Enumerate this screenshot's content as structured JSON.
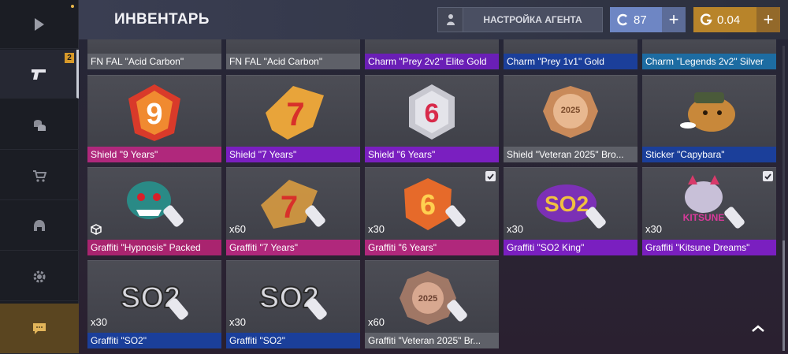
{
  "header": {
    "title": "ИНВЕНТАРЬ",
    "agent_button": "НАСТРОЙКА АГЕНТА",
    "currency_blue": "87",
    "currency_gold": "0.04",
    "plus": "+"
  },
  "sidebar": {
    "items": [
      {
        "icon": "play-icon"
      },
      {
        "icon": "pistol-icon",
        "badge": "2"
      },
      {
        "icon": "coins-icon"
      },
      {
        "icon": "cart-icon"
      },
      {
        "icon": "helmet-icon"
      },
      {
        "icon": "gear-icon"
      },
      {
        "icon": "chat-icon"
      }
    ]
  },
  "colors": {
    "grey": "#5e6068",
    "purple": "#6a1fb6",
    "blue": "#1b3f9a",
    "teal": "#1d6ca2",
    "pink": "#b0287c",
    "violet": "#7a1fc0",
    "magenta": "#a9246f"
  },
  "items": [
    {
      "name": "FN FAL \"Acid Carbon\"",
      "qty": "",
      "rarity": "grey"
    },
    {
      "name": "FN FAL \"Acid Carbon\"",
      "qty": "",
      "rarity": "grey"
    },
    {
      "name": "Charm \"Prey 2v2\" Elite Gold",
      "qty": "",
      "rarity": "purple"
    },
    {
      "name": "Charm \"Prey 1v1\" Gold",
      "qty": "",
      "rarity": "blue"
    },
    {
      "name": "Charm \"Legends 2v2\" Silver",
      "qty": "",
      "rarity": "teal"
    },
    {
      "name": "Shield \"9 Years\"",
      "qty": "",
      "rarity": "pink"
    },
    {
      "name": "Shield \"7 Years\"",
      "qty": "",
      "rarity": "violet"
    },
    {
      "name": "Shield \"6 Years\"",
      "qty": "",
      "rarity": "violet"
    },
    {
      "name": "Shield \"Veteran 2025\" Bro...",
      "qty": "",
      "rarity": "grey"
    },
    {
      "name": "Sticker \"Capybara\"",
      "qty": "",
      "rarity": "blue"
    },
    {
      "name": "Graffiti \"Hypnosis\" Packed",
      "qty": "",
      "rarity": "magenta",
      "checked": false,
      "packed": true
    },
    {
      "name": "Graffiti \"7 Years\"",
      "qty": "x60",
      "rarity": "pink"
    },
    {
      "name": "Graffiti \"6 Years\"",
      "qty": "x30",
      "rarity": "pink",
      "checked": true
    },
    {
      "name": "Graffiti \"SO2 King\"",
      "qty": "x30",
      "rarity": "violet"
    },
    {
      "name": "Graffiti \"Kitsune Dreams\"",
      "qty": "x30",
      "rarity": "violet",
      "checked": true
    },
    {
      "name": "Graffiti \"SO2\"",
      "qty": "x30",
      "rarity": "blue"
    },
    {
      "name": "Graffiti \"SO2\"",
      "qty": "x30",
      "rarity": "blue"
    },
    {
      "name": "Graffiti \"Veteran 2025\" Br...",
      "qty": "x60",
      "rarity": "grey"
    }
  ],
  "art_text": {
    "shield_9": "9",
    "shield_7": "7",
    "shield_6": "6",
    "veteran": "2025",
    "so2": "SO2",
    "kitsune": "KITSUNE"
  }
}
